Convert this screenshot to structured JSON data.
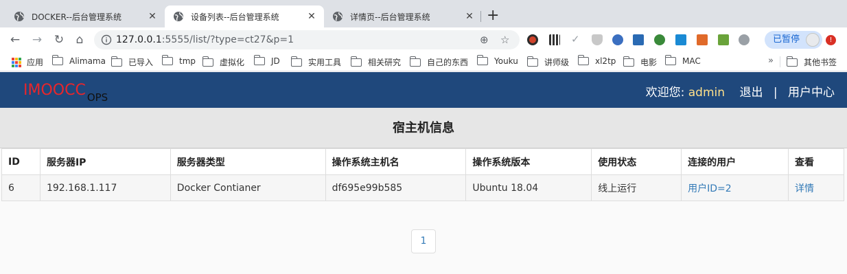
{
  "browser": {
    "tabs": [
      {
        "title": "DOCKER--后台管理系统",
        "active": false
      },
      {
        "title": "设备列表--后台管理系统",
        "active": true
      },
      {
        "title": "详情页--后台管理系统",
        "active": false
      }
    ],
    "new_tab": "+",
    "url_host": "127.0.0.1",
    "url_rest": ":5555/list/?type=ct27&p=1",
    "profile_label": "已暂停",
    "update_badge": "!"
  },
  "bookmarks": [
    {
      "label": "应用",
      "icon": "apps-grid-icon"
    },
    {
      "label": "Alimama",
      "icon": "folder-icon"
    },
    {
      "label": "已导入",
      "icon": "folder-icon"
    },
    {
      "label": "tmp",
      "icon": "folder-icon"
    },
    {
      "label": "虚拟化",
      "icon": "folder-icon"
    },
    {
      "label": "JD",
      "icon": "folder-icon"
    },
    {
      "label": "实用工具",
      "icon": "folder-icon"
    },
    {
      "label": "相关研究",
      "icon": "folder-icon"
    },
    {
      "label": "自己的东西",
      "icon": "folder-icon"
    },
    {
      "label": "Youku",
      "icon": "folder-icon"
    },
    {
      "label": "讲师级",
      "icon": "folder-icon"
    },
    {
      "label": "xl2tp",
      "icon": "folder-icon"
    },
    {
      "label": "电影",
      "icon": "folder-icon"
    },
    {
      "label": "MAC",
      "icon": "folder-icon"
    }
  ],
  "bookmarks_overflow": "»",
  "other_bookmarks": "其他书签",
  "app": {
    "brand": "IMOOCC",
    "brand_sub": "OPS",
    "welcome": "欢迎您:",
    "username": "admin",
    "logout": "退出",
    "separator": "|",
    "user_center": "用户中心",
    "colors": {
      "navbar": "#1f487c",
      "brand": "#e8262b",
      "link": "#337ab7"
    }
  },
  "panel_title": "宿主机信息",
  "table": {
    "headers": [
      "ID",
      "服务器IP",
      "服务器类型",
      "操作系统主机名",
      "操作系统版本",
      "使用状态",
      "连接的用户",
      "查看"
    ],
    "rows": [
      [
        "6",
        "192.168.1.117",
        "Docker Contianer",
        "df695e99b585",
        "Ubuntu 18.04",
        "线上运行",
        "用户ID=2",
        "详情"
      ]
    ]
  },
  "pagination": {
    "current_page": "1"
  }
}
